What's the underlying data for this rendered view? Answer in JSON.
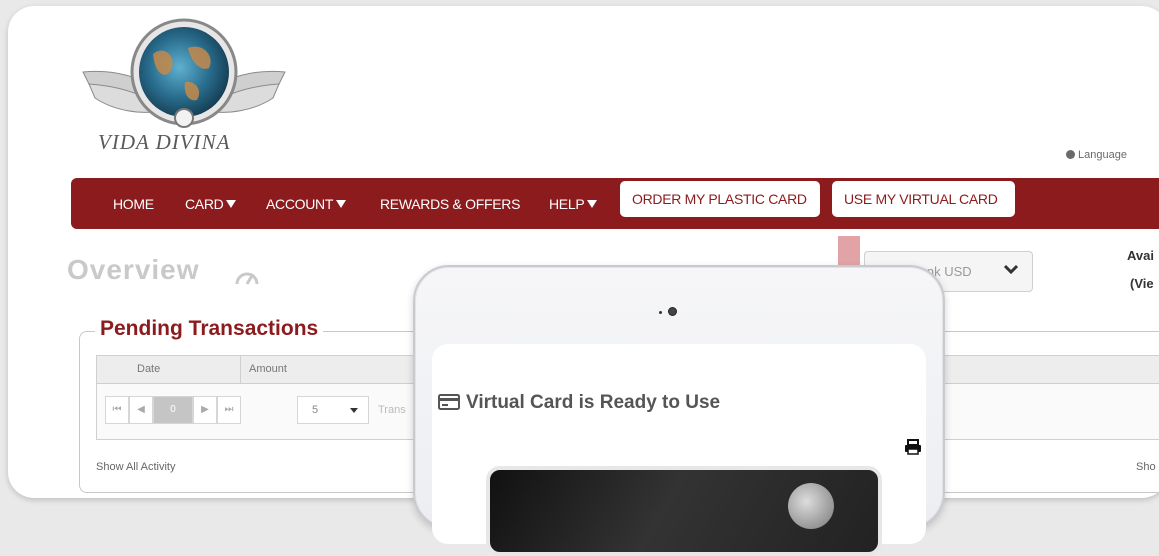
{
  "brand": {
    "name": "VIDA DIVINA"
  },
  "language": {
    "label": "Language"
  },
  "nav": {
    "items": [
      {
        "label": "HOME"
      },
      {
        "label": "CARD"
      },
      {
        "label": "ACCOUNT"
      },
      {
        "label": "REWARDS & OFFERS"
      },
      {
        "label": "HELP"
      }
    ],
    "order_plastic_card": "ORDER MY PLASTIC CARD",
    "use_virtual_card": "USE MY VIRTUAL CARD"
  },
  "overview": {
    "title": "Overview",
    "account_select_value": "Bank USD",
    "available_label": "Avai",
    "view_label": "(Vie"
  },
  "pending": {
    "title": "Pending Transactions",
    "columns": [
      "Date",
      "Amount"
    ],
    "pager": {
      "first": "⏮",
      "prev": "◀",
      "current": "0",
      "next": "▶",
      "last": "⏭",
      "page_size": "5",
      "transactions_label": "Trans"
    },
    "show_all": "Show All Activity",
    "show_right": "Sho"
  },
  "modal": {
    "title": "Virtual Card is Ready to Use"
  },
  "colors": {
    "brand_red": "#8c1b1d",
    "muted_text": "#c9c9c9"
  }
}
